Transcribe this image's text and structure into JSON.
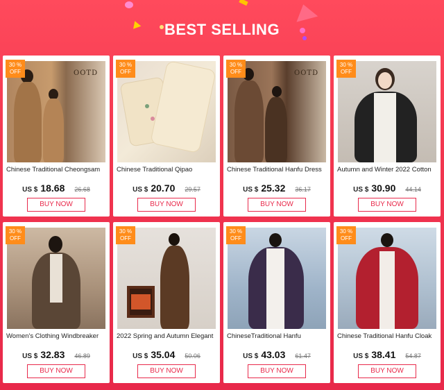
{
  "header": {
    "title": "BEST SELLING"
  },
  "products": [
    {
      "discount_pct": "30 %",
      "discount_label": "OFF",
      "name": "Chinese Traditional Cheongsam",
      "currency": "US $",
      "price": "18.68",
      "old_price": "26.68",
      "buy_label": "BUY NOW",
      "overlay_text": "OOTD"
    },
    {
      "discount_pct": "30 %",
      "discount_label": "OFF",
      "name": "Chinese Traditional Qipao",
      "currency": "US $",
      "price": "20.70",
      "old_price": "29.57",
      "buy_label": "BUY NOW"
    },
    {
      "discount_pct": "30 %",
      "discount_label": "OFF",
      "name": "Chinese Traditional Hanfu Dress",
      "currency": "US $",
      "price": "25.32",
      "old_price": "36.17",
      "buy_label": "BUY NOW",
      "overlay_text": "OOTD"
    },
    {
      "discount_pct": "30 %",
      "discount_label": "OFF",
      "name": "Autumn and Winter 2022 Cotton",
      "currency": "US $",
      "price": "30.90",
      "old_price": "44.14",
      "buy_label": "BUY NOW"
    },
    {
      "discount_pct": "30 %",
      "discount_label": "OFF",
      "name": "Women's Clothing Windbreaker",
      "currency": "US $",
      "price": "32.83",
      "old_price": "46.89",
      "buy_label": "BUY NOW"
    },
    {
      "discount_pct": "30 %",
      "discount_label": "OFF",
      "name": "2022 Spring and Autumn Elegant",
      "currency": "US $",
      "price": "35.04",
      "old_price": "50.06",
      "buy_label": "BUY NOW"
    },
    {
      "discount_pct": "30 %",
      "discount_label": "OFF",
      "name": "ChineseTraditional Hanfu",
      "currency": "US $",
      "price": "43.03",
      "old_price": "61.47",
      "buy_label": "BUY NOW"
    },
    {
      "discount_pct": "30 %",
      "discount_label": "OFF",
      "name": "Chinese Traditional Hanfu Cloak",
      "currency": "US $",
      "price": "38.41",
      "old_price": "54.87",
      "buy_label": "BUY NOW"
    }
  ],
  "colors": {
    "accent": "#e8294a",
    "discount_badge": "#ff8c1a"
  }
}
